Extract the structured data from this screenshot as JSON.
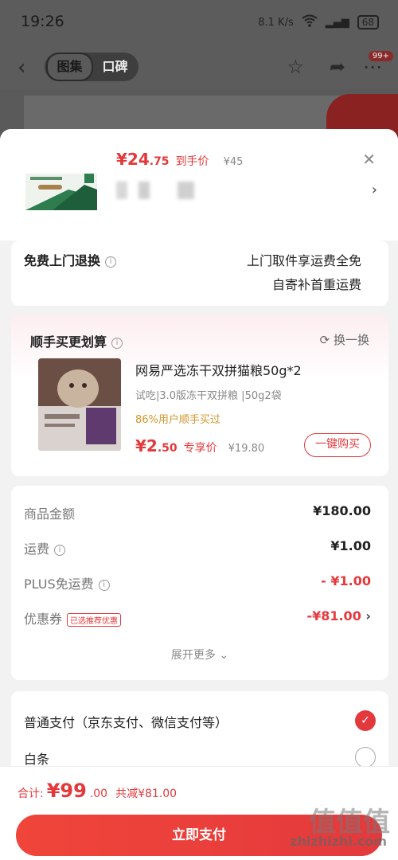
{
  "status_bar": {
    "time": "19:26",
    "net_speed": "8.1 K/s",
    "battery": "68"
  },
  "nav": {
    "tabs": [
      "图集",
      "口碑"
    ],
    "active_tab": 0,
    "badge": "99+"
  },
  "product": {
    "price_int": "¥24",
    "price_dec": ".75",
    "price_label": "到手价",
    "orig_price": "¥45"
  },
  "return_service": {
    "title": "免费上门退换",
    "desc_line1": "上门取件享运费全免",
    "desc_line2": "自寄补首重运费"
  },
  "upsell": {
    "title": "顺手买更划算",
    "swap_label": "换一换",
    "name": "网易严选冻干双拼猫粮50g*2",
    "spec": "试吃|3.0版冻干双拼粮 |50g2袋",
    "stat": "86%用户顺手买过",
    "price_int": "¥2",
    "price_dec": ".50",
    "price_label": "专享价",
    "orig_price": "¥19.80",
    "buy_label": "一键购买"
  },
  "summary": {
    "rows": [
      {
        "label": "商品金额",
        "value": "¥180.00"
      },
      {
        "label": "运费",
        "value": "¥1.00"
      },
      {
        "label": "PLUS免运费",
        "value": "- ¥1.00"
      },
      {
        "label": "优惠券",
        "value": "-¥81.00",
        "tag": "已选推荐优惠"
      }
    ],
    "expand_label": "展开更多"
  },
  "payment": {
    "options": [
      {
        "label": "普通支付（京东支付、微信支付等）",
        "selected": true
      },
      {
        "label": "白条",
        "selected": false
      }
    ]
  },
  "footer": {
    "total_label": "合计:",
    "total_int": "¥99",
    "total_dec": ".00",
    "saved": "共减¥81.00",
    "pay_label": "立即支付",
    "watermark_cn": "值值值",
    "watermark_url": "zhizhizhi.com"
  },
  "colors": {
    "accent": "#e4393c"
  }
}
